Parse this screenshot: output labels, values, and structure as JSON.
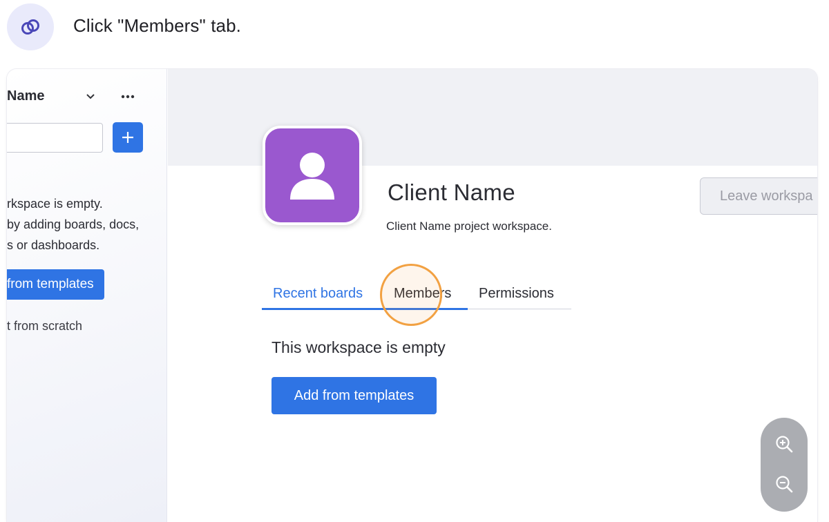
{
  "instruction": {
    "text": "Click \"Members\" tab.",
    "icon": "link-icon"
  },
  "left_panel": {
    "title": "Name",
    "search_value": "",
    "empty_lines": [
      "rkspace is empty.",
      "by adding boards, docs,",
      "s or dashboards."
    ],
    "add_templates_label": "from templates",
    "start_scratch_label": "t from scratch"
  },
  "workspace": {
    "title": "Client Name",
    "description": "Client Name project workspace.",
    "leave_label": "Leave workspa",
    "tabs": [
      {
        "label": "Recent boards",
        "active": true
      },
      {
        "label": "Members",
        "active": false
      },
      {
        "label": "Permissions",
        "active": false
      }
    ],
    "empty_message": "This workspace is empty",
    "add_templates_label": "Add from templates"
  },
  "colors": {
    "primary": "#2f74e4",
    "avatar": "#9a58cf",
    "highlight": "#f2a142"
  }
}
